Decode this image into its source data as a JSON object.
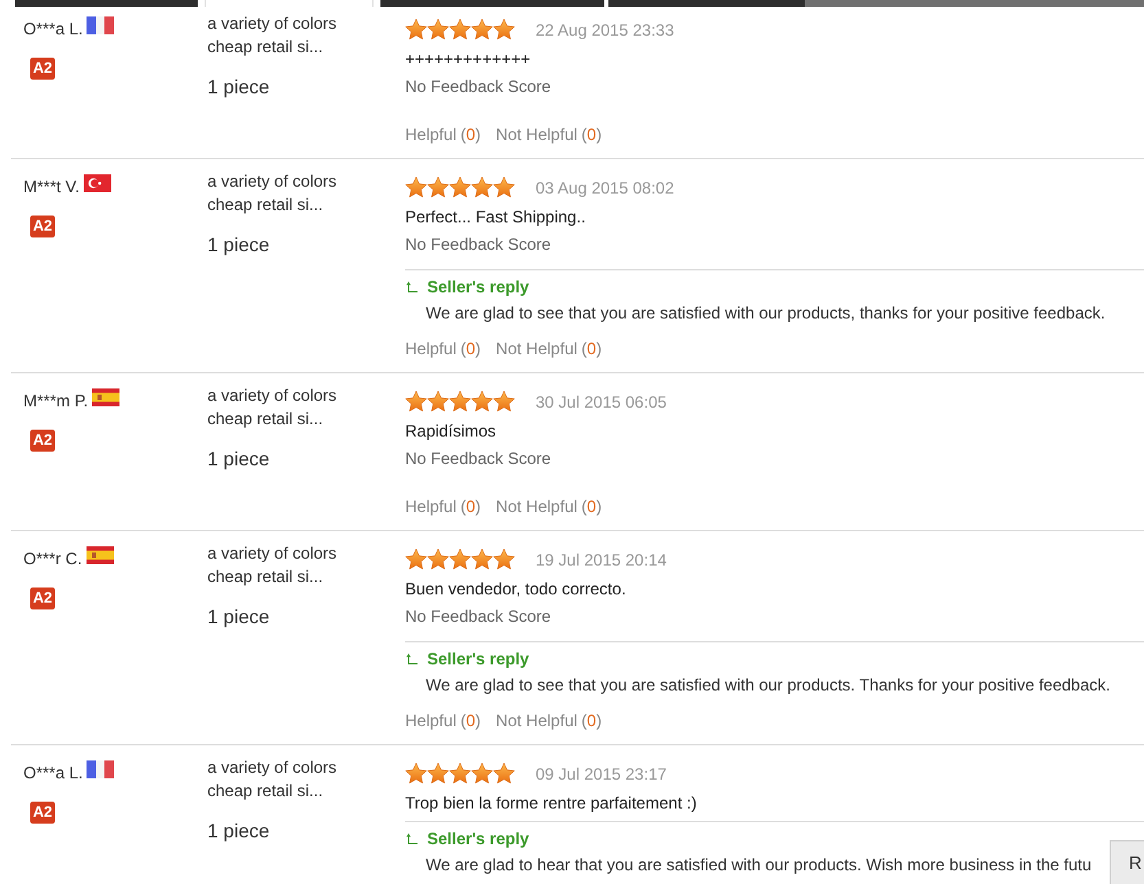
{
  "tabs": [
    {
      "selected": false
    },
    {
      "selected": true
    },
    {
      "selected": false
    },
    {
      "selected": false
    }
  ],
  "reviews": [
    {
      "buyer": "O***a L.",
      "flag": {
        "kind": "fr"
      },
      "level": "A2",
      "product": "a variety of colors cheap retail si...",
      "quantity": "1 piece",
      "stars": 5,
      "date": "22 Aug 2015 23:33",
      "text": "+++++++++++++",
      "feedback_score": "No Feedback Score",
      "helpful": {
        "label": "Helpful",
        "count": "(0)"
      },
      "not_helpful": {
        "label": "Not Helpful",
        "count": "(0)"
      }
    },
    {
      "buyer": "M***t V.",
      "flag": {
        "kind": "tr"
      },
      "level": "A2",
      "product": "a variety of colors cheap retail si...",
      "quantity": "1 piece",
      "stars": 5,
      "date": "03 Aug 2015 08:02",
      "text": "Perfect... Fast Shipping..",
      "feedback_score": "No Feedback Score",
      "seller_reply": {
        "title": "Seller's reply",
        "text": "We are glad to see that you are satisfied with our products, thanks for your positive feedback."
      },
      "helpful": {
        "label": "Helpful",
        "count": "(0)"
      },
      "not_helpful": {
        "label": "Not Helpful",
        "count": "(0)"
      }
    },
    {
      "buyer": "M***m P.",
      "flag": {
        "kind": "es"
      },
      "level": "A2",
      "product": "a variety of colors cheap retail si...",
      "quantity": "1 piece",
      "stars": 5,
      "date": "30 Jul 2015 06:05",
      "text": "Rapidísimos",
      "feedback_score": "No Feedback Score",
      "helpful": {
        "label": "Helpful",
        "count": "(0)"
      },
      "not_helpful": {
        "label": "Not Helpful",
        "count": "(0)"
      }
    },
    {
      "buyer": "O***r C.",
      "flag": {
        "kind": "es"
      },
      "level": "A2",
      "product": "a variety of colors cheap retail si...",
      "quantity": "1 piece",
      "stars": 5,
      "date": "19 Jul 2015 20:14",
      "text": "Buen vendedor, todo correcto.",
      "feedback_score": "No Feedback Score",
      "seller_reply": {
        "title": "Seller's reply",
        "text": "We are glad to see that you are satisfied with our products. Thanks for your positive feedback."
      },
      "helpful": {
        "label": "Helpful",
        "count": "(0)"
      },
      "not_helpful": {
        "label": "Not Helpful",
        "count": "(0)"
      }
    },
    {
      "buyer": "O***a L.",
      "flag": {
        "kind": "fr"
      },
      "level": "A2",
      "product": "a variety of colors cheap retail si...",
      "quantity": "1 piece",
      "stars": 5,
      "date": "09 Jul 2015 23:17",
      "text": "Trop bien la forme rentre parfaitement :)",
      "seller_reply": {
        "title": "Seller's reply",
        "text": "We are glad to hear that you are satisfied with our products. Wish more business in the futu"
      }
    }
  ],
  "corner_button": {
    "label": "R"
  }
}
